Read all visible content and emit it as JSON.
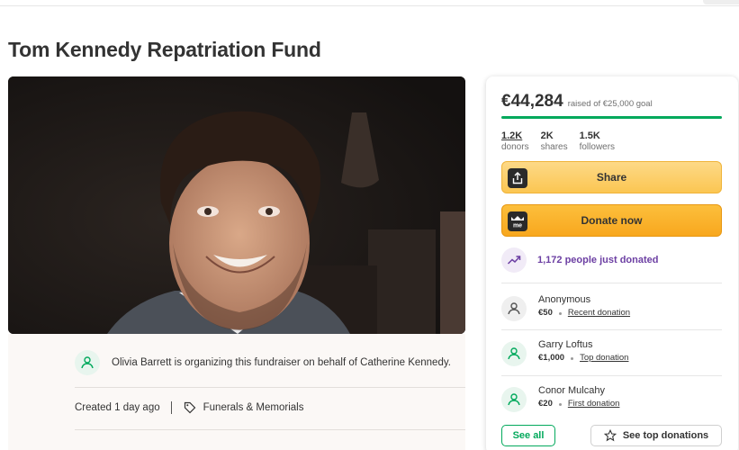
{
  "page": {
    "title": "Tom Kennedy Repatriation Fund"
  },
  "organizer": {
    "text": "Olivia Barrett is organizing this fundraiser on behalf of Catherine Kennedy."
  },
  "meta": {
    "created": "Created 1 day ago",
    "category": "Funerals & Memorials"
  },
  "donation_card": {
    "amount_raised": "€44,284",
    "goal_text": "raised of €25,000 goal",
    "progress_fraction": 1.0,
    "stats": [
      {
        "value": "1.2K",
        "label": "donors"
      },
      {
        "value": "2K",
        "label": "shares"
      },
      {
        "value": "1.5K",
        "label": "followers"
      }
    ],
    "share_label": "Share",
    "donate_label": "Donate now",
    "donate_icon_text": "me",
    "trend_text": "1,172 people just donated",
    "donations": [
      {
        "name": "Anonymous",
        "amount": "€50",
        "kind": "Recent donation"
      },
      {
        "name": "Garry Loftus",
        "amount": "€1,000",
        "kind": "Top donation"
      },
      {
        "name": "Conor Mulcahy",
        "amount": "€20",
        "kind": "First donation"
      }
    ],
    "see_all_label": "See all",
    "see_top_label": "See top donations"
  },
  "colors": {
    "accent_green": "#02a95c",
    "share_button": "#fbc652",
    "donate_button": "#f8a71e",
    "trend_purple": "#6c3fa3"
  }
}
